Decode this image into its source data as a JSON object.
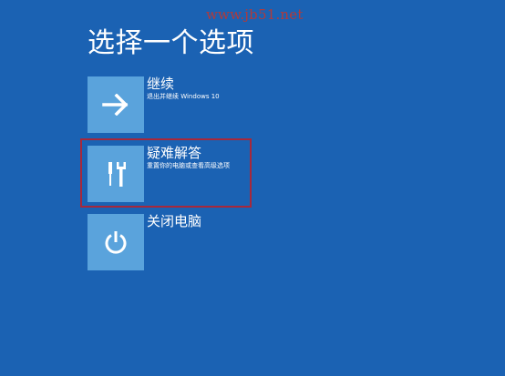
{
  "watermark": "www.jb51.net",
  "title": "选择一个选项",
  "options": [
    {
      "label": "继续",
      "description": "退出并继续 Windows 10",
      "icon": "arrow-right-icon"
    },
    {
      "label": "疑难解答",
      "description": "重置你的电脑或查看高级选项",
      "icon": "tools-icon",
      "highlighted": true
    },
    {
      "label": "关闭电脑",
      "description": "",
      "icon": "power-icon"
    }
  ],
  "colors": {
    "background": "#1b62b3",
    "tile": "#5aa3dc",
    "highlight_border": "#a7283b",
    "watermark": "#b23a3a"
  }
}
